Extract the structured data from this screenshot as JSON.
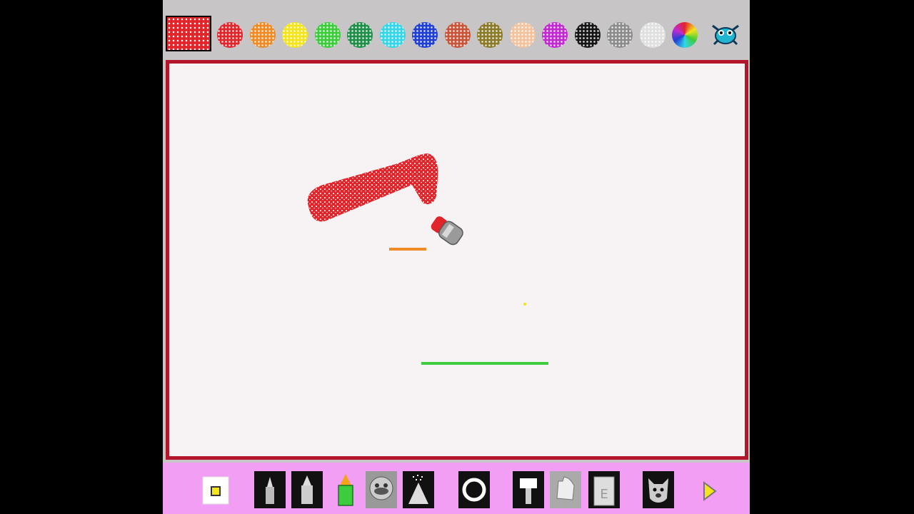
{
  "palette": {
    "current_color": "#e2242b",
    "swatches": [
      {
        "name": "red",
        "color": "#e2242b"
      },
      {
        "name": "orange",
        "color": "#f08a24"
      },
      {
        "name": "yellow",
        "color": "#f4e41c"
      },
      {
        "name": "light-green",
        "color": "#3ccc3c"
      },
      {
        "name": "dark-green",
        "color": "#1f8f4a"
      },
      {
        "name": "cyan",
        "color": "#34d6e8"
      },
      {
        "name": "blue",
        "color": "#1f3fd6"
      },
      {
        "name": "brown-red",
        "color": "#c8543a"
      },
      {
        "name": "olive",
        "color": "#8a7a2a"
      },
      {
        "name": "peach",
        "color": "#f4c29c"
      },
      {
        "name": "purple",
        "color": "#c02ad0"
      },
      {
        "name": "black",
        "color": "#151515"
      },
      {
        "name": "gray",
        "color": "#8c8c8c"
      },
      {
        "name": "light-gray",
        "color": "#e0e0e0"
      },
      {
        "name": "rainbow",
        "color": "#e26a2a"
      }
    ]
  },
  "canvas": {
    "background": "#f7f3f4",
    "border_color": "#b3162a",
    "active_tool": "spray-can"
  },
  "toolbar": {
    "background": "#f29ef4",
    "tools": [
      "brush-size-small",
      "pencil-thin",
      "pencil-thick",
      "crayon-green",
      "stamp-mario",
      "spray-can",
      "shape-circle",
      "paint-brush",
      "eraser-hand",
      "eraser-block",
      "undo-dog",
      "next-arrow"
    ]
  }
}
